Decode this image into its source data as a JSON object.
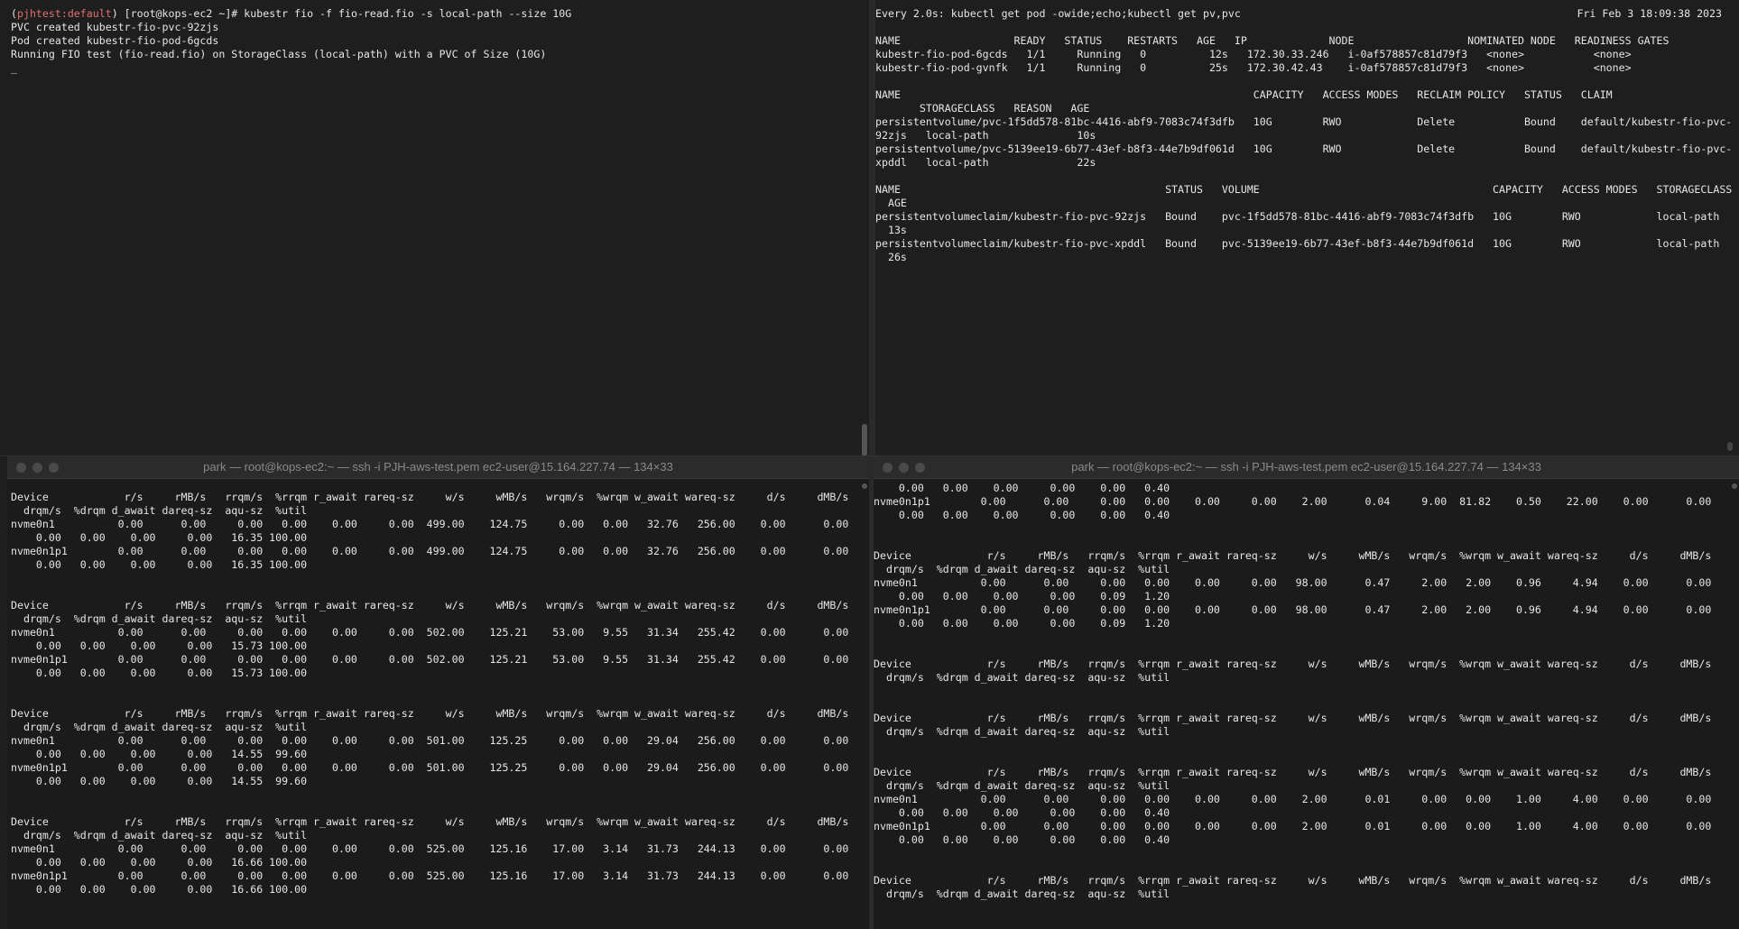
{
  "top_left": {
    "prompt_context": "pjhtest:default",
    "prompt_rest": " [root@kops-ec2 ~]# ",
    "command": "kubestr fio -f fio-read.fio -s local-path --size 10G",
    "output": "PVC created kubestr-fio-pvc-92zjs\nPod created kubestr-fio-pod-6gcds\nRunning FIO test (fio-read.fio) on StorageClass (local-path) with a PVC of Size (10G)\n_"
  },
  "top_right": {
    "header": "Every 2.0s: kubectl get pod -owide;echo;kubectl get pv,pvc",
    "clock": "Fri Feb  3 18:09:38 2023",
    "body": "NAME                  READY   STATUS    RESTARTS   AGE   IP             NODE                  NOMINATED NODE   READINESS GATES\nkubestr-fio-pod-6gcds   1/1     Running   0          12s   172.30.33.246   i-0af578857c81d79f3   <none>           <none>\nkubestr-fio-pod-gvnfk   1/1     Running   0          25s   172.30.42.43    i-0af578857c81d79f3   <none>           <none>\n\nNAME                                                        CAPACITY   ACCESS MODES   RECLAIM POLICY   STATUS   CLAIM\n       STORAGECLASS   REASON   AGE\npersistentvolume/pvc-1f5dd578-81bc-4416-abf9-7083c74f3dfb   10G        RWO            Delete           Bound    default/kubestr-fio-pvc-\n92zjs   local-path              10s\npersistentvolume/pvc-5139ee19-6b77-43ef-b8f3-44e7b9df061d   10G        RWO            Delete           Bound    default/kubestr-fio-pvc-\nxpddl   local-path              22s\n\nNAME                                          STATUS   VOLUME                                     CAPACITY   ACCESS MODES   STORAGECLASS\n  AGE\npersistentvolumeclaim/kubestr-fio-pvc-92zjs   Bound    pvc-1f5dd578-81bc-4416-abf9-7083c74f3dfb   10G        RWO            local-path\n  13s\npersistentvolumeclaim/kubestr-fio-pvc-xpddl   Bound    pvc-5139ee19-6b77-43ef-b8f3-44e7b9df061d   10G        RWO            local-path\n  26s"
  },
  "bottom_left": {
    "title": "park — root@kops-ec2:~ — ssh -i PJH-aws-test.pem ec2-user@15.164.227.74 — 134×33",
    "body": "Device            r/s     rMB/s   rrqm/s  %rrqm r_await rareq-sz     w/s     wMB/s   wrqm/s  %wrqm w_await wareq-sz     d/s     dMB/s\n  drqm/s  %drqm d_await dareq-sz  aqu-sz  %util\nnvme0n1          0.00      0.00     0.00   0.00    0.00     0.00  499.00    124.75     0.00   0.00   32.76   256.00    0.00      0.00\n    0.00   0.00    0.00     0.00   16.35 100.00\nnvme0n1p1        0.00      0.00     0.00   0.00    0.00     0.00  499.00    124.75     0.00   0.00   32.76   256.00    0.00      0.00\n    0.00   0.00    0.00     0.00   16.35 100.00\n\n\nDevice            r/s     rMB/s   rrqm/s  %rrqm r_await rareq-sz     w/s     wMB/s   wrqm/s  %wrqm w_await wareq-sz     d/s     dMB/s\n  drqm/s  %drqm d_await dareq-sz  aqu-sz  %util\nnvme0n1          0.00      0.00     0.00   0.00    0.00     0.00  502.00    125.21    53.00   9.55   31.34   255.42    0.00      0.00\n    0.00   0.00    0.00     0.00   15.73 100.00\nnvme0n1p1        0.00      0.00     0.00   0.00    0.00     0.00  502.00    125.21    53.00   9.55   31.34   255.42    0.00      0.00\n    0.00   0.00    0.00     0.00   15.73 100.00\n\n\nDevice            r/s     rMB/s   rrqm/s  %rrqm r_await rareq-sz     w/s     wMB/s   wrqm/s  %wrqm w_await wareq-sz     d/s     dMB/s\n  drqm/s  %drqm d_await dareq-sz  aqu-sz  %util\nnvme0n1          0.00      0.00     0.00   0.00    0.00     0.00  501.00    125.25     0.00   0.00   29.04   256.00    0.00      0.00\n    0.00   0.00    0.00     0.00   14.55  99.60\nnvme0n1p1        0.00      0.00     0.00   0.00    0.00     0.00  501.00    125.25     0.00   0.00   29.04   256.00    0.00      0.00\n    0.00   0.00    0.00     0.00   14.55  99.60\n\n\nDevice            r/s     rMB/s   rrqm/s  %rrqm r_await rareq-sz     w/s     wMB/s   wrqm/s  %wrqm w_await wareq-sz     d/s     dMB/s\n  drqm/s  %drqm d_await dareq-sz  aqu-sz  %util\nnvme0n1          0.00      0.00     0.00   0.00    0.00     0.00  525.00    125.16    17.00   3.14   31.73   244.13    0.00      0.00\n    0.00   0.00    0.00     0.00   16.66 100.00\nnvme0n1p1        0.00      0.00     0.00   0.00    0.00     0.00  525.00    125.16    17.00   3.14   31.73   244.13    0.00      0.00\n    0.00   0.00    0.00     0.00   16.66 100.00"
  },
  "bottom_right": {
    "title": "park — root@kops-ec2:~ — ssh -i PJH-aws-test.pem ec2-user@15.164.227.74 — 134×33",
    "body": "    0.00   0.00    0.00     0.00    0.00   0.40\nnvme0n1p1        0.00      0.00     0.00   0.00    0.00     0.00    2.00      0.04     9.00  81.82    0.50    22.00    0.00      0.00\n    0.00   0.00    0.00     0.00    0.00   0.40\n\n\nDevice            r/s     rMB/s   rrqm/s  %rrqm r_await rareq-sz     w/s     wMB/s   wrqm/s  %wrqm w_await wareq-sz     d/s     dMB/s\n  drqm/s  %drqm d_await dareq-sz  aqu-sz  %util\nnvme0n1          0.00      0.00     0.00   0.00    0.00     0.00   98.00      0.47     2.00   2.00    0.96     4.94    0.00      0.00\n    0.00   0.00    0.00     0.00    0.09   1.20\nnvme0n1p1        0.00      0.00     0.00   0.00    0.00     0.00   98.00      0.47     2.00   2.00    0.96     4.94    0.00      0.00\n    0.00   0.00    0.00     0.00    0.09   1.20\n\n\nDevice            r/s     rMB/s   rrqm/s  %rrqm r_await rareq-sz     w/s     wMB/s   wrqm/s  %wrqm w_await wareq-sz     d/s     dMB/s\n  drqm/s  %drqm d_await dareq-sz  aqu-sz  %util\n\n\nDevice            r/s     rMB/s   rrqm/s  %rrqm r_await rareq-sz     w/s     wMB/s   wrqm/s  %wrqm w_await wareq-sz     d/s     dMB/s\n  drqm/s  %drqm d_await dareq-sz  aqu-sz  %util\n\n\nDevice            r/s     rMB/s   rrqm/s  %rrqm r_await rareq-sz     w/s     wMB/s   wrqm/s  %wrqm w_await wareq-sz     d/s     dMB/s\n  drqm/s  %drqm d_await dareq-sz  aqu-sz  %util\nnvme0n1          0.00      0.00     0.00   0.00    0.00     0.00    2.00      0.01     0.00   0.00    1.00     4.00    0.00      0.00\n    0.00   0.00    0.00     0.00    0.00   0.40\nnvme0n1p1        0.00      0.00     0.00   0.00    0.00     0.00    2.00      0.01     0.00   0.00    1.00     4.00    0.00      0.00\n    0.00   0.00    0.00     0.00    0.00   0.40\n\n\nDevice            r/s     rMB/s   rrqm/s  %rrqm r_await rareq-sz     w/s     wMB/s   wrqm/s  %wrqm w_await wareq-sz     d/s     dMB/s\n  drqm/s  %drqm d_await dareq-sz  aqu-sz  %util"
  }
}
